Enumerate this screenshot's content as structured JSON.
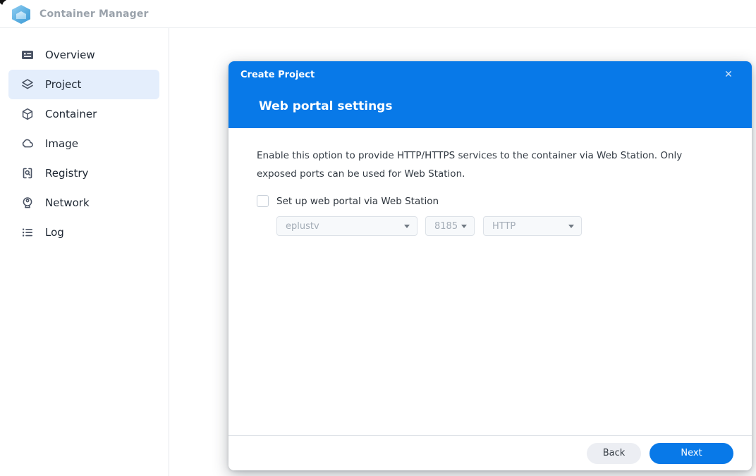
{
  "topbar": {
    "title": "Container Manager"
  },
  "sidebar": {
    "items": [
      {
        "label": "Overview",
        "icon": "overview-icon",
        "active": false
      },
      {
        "label": "Project",
        "icon": "project-icon",
        "active": true
      },
      {
        "label": "Container",
        "icon": "container-icon",
        "active": false
      },
      {
        "label": "Image",
        "icon": "image-icon",
        "active": false
      },
      {
        "label": "Registry",
        "icon": "registry-icon",
        "active": false
      },
      {
        "label": "Network",
        "icon": "network-icon",
        "active": false
      },
      {
        "label": "Log",
        "icon": "log-icon",
        "active": false
      }
    ]
  },
  "dialog": {
    "title": "Create Project",
    "subtitle": "Web portal settings",
    "close_glyph": "✕",
    "description": "Enable this option to provide HTTP/HTTPS services to the container via Web Station. Only exposed ports can be used for Web Station.",
    "checkbox": {
      "label": "Set up web portal via Web Station",
      "checked": false
    },
    "selects": [
      {
        "value": "eplustv",
        "disabled": true
      },
      {
        "value": "8185",
        "disabled": true
      },
      {
        "value": "HTTP",
        "disabled": true
      }
    ],
    "footer": {
      "back_label": "Back",
      "next_label": "Next"
    }
  },
  "colors": {
    "primary_blue": "#0879e8",
    "selected_item_bg": "#e4eefc",
    "disabled_text": "#a4adb7"
  }
}
